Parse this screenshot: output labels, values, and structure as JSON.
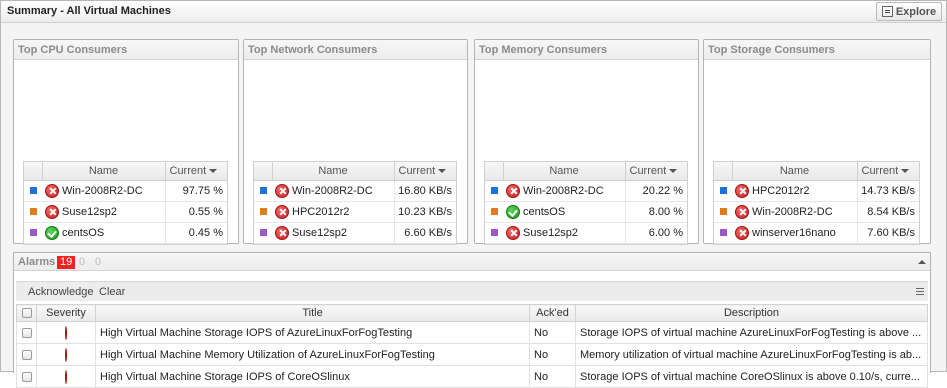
{
  "window": {
    "title": "Summary - All Virtual Machines",
    "explore_label": "Explore"
  },
  "columns": {
    "name": "Name",
    "current": "Current"
  },
  "colors": {
    "blue": "#1e73d8",
    "orange": "#e07b1e",
    "purple": "#9b59c6"
  },
  "panels": [
    {
      "title": "Top CPU Consumers",
      "rows": [
        {
          "swatch": "blue",
          "status": "error",
          "name": "Win-2008R2-DC",
          "value": "97.75 %"
        },
        {
          "swatch": "orange",
          "status": "error",
          "name": "Suse12sp2",
          "value": "0.55 %"
        },
        {
          "swatch": "purple",
          "status": "ok",
          "name": "centsOS",
          "value": "0.45 %"
        }
      ]
    },
    {
      "title": "Top Network Consumers",
      "rows": [
        {
          "swatch": "blue",
          "status": "error",
          "name": "Win-2008R2-DC",
          "value": "16.80 KB/s"
        },
        {
          "swatch": "orange",
          "status": "error",
          "name": "HPC2012r2",
          "value": "10.23 KB/s"
        },
        {
          "swatch": "purple",
          "status": "error",
          "name": "Suse12sp2",
          "value": "6.60 KB/s"
        }
      ]
    },
    {
      "title": "Top Memory Consumers",
      "rows": [
        {
          "swatch": "blue",
          "status": "error",
          "name": "Win-2008R2-DC",
          "value": "20.22 %"
        },
        {
          "swatch": "orange",
          "status": "ok",
          "name": "centsOS",
          "value": "8.00 %"
        },
        {
          "swatch": "purple",
          "status": "error",
          "name": "Suse12sp2",
          "value": "6.00 %"
        }
      ]
    },
    {
      "title": "Top Storage Consumers",
      "rows": [
        {
          "swatch": "blue",
          "status": "error",
          "name": "HPC2012r2",
          "value": "14.73 KB/s"
        },
        {
          "swatch": "orange",
          "status": "error",
          "name": "Win-2008R2-DC",
          "value": "8.54 KB/s"
        },
        {
          "swatch": "purple",
          "status": "error",
          "name": "winserver16nano",
          "value": "7.60 KB/s"
        }
      ]
    }
  ],
  "alarms": {
    "label": "Alarms",
    "count_critical": "19",
    "count_warning": "0",
    "count_info": "0",
    "toolbar": {
      "acknowledge": "Acknowledge",
      "clear": "Clear"
    },
    "headers": {
      "severity": "Severity",
      "title": "Title",
      "acked": "Ack'ed",
      "description": "Description"
    },
    "rows": [
      {
        "severity": "error",
        "title": "High Virtual Machine Storage IOPS of AzureLinuxForFogTesting",
        "acked": "No",
        "description": "Storage IOPS of virtual machine AzureLinuxForFogTesting is above ..."
      },
      {
        "severity": "error",
        "title": "High Virtual Machine Memory Utilization of AzureLinuxForFogTesting",
        "acked": "No",
        "description": "Memory utilization of virtual machine AzureLinuxForFogTesting is ab..."
      },
      {
        "severity": "error",
        "title": "High Virtual Machine Storage IOPS of CoreOSlinux",
        "acked": "No",
        "description": "Storage IOPS of virtual machine CoreOSlinux is above 0.10/s, curre..."
      }
    ]
  }
}
